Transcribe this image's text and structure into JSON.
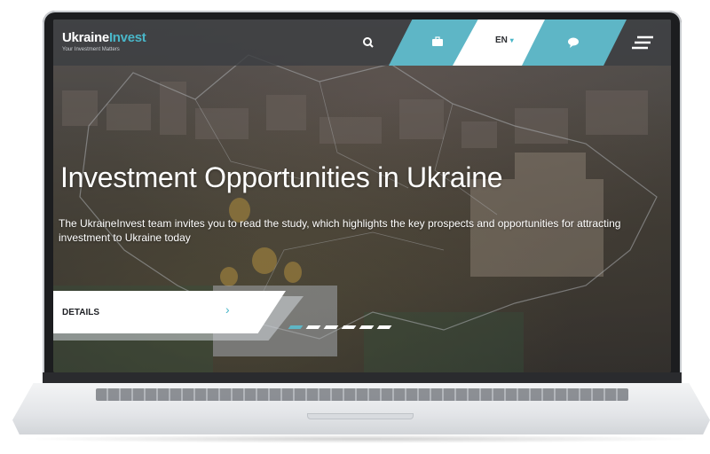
{
  "header": {
    "logo_main": "Ukraine",
    "logo_accent": "Invest",
    "logo_tagline": "Your Investment Matters",
    "language": "EN",
    "icons": [
      "search-icon",
      "briefcase-icon",
      "chevron-down-icon",
      "chat-icon",
      "menu-icon"
    ]
  },
  "hero": {
    "title": "Investment Opportunities in Ukraine",
    "description": "The UkraineInvest team invites you to read the study, which highlights the key prospects and opportunities for attracting investment to Ukraine today",
    "details_label": "DETAILS",
    "slide_count": 6,
    "active_slide": 1
  },
  "colors": {
    "accent": "#5eb6c6",
    "logo_accent": "#49b6c8",
    "bar": "#3c3e42",
    "white": "#ffffff"
  }
}
